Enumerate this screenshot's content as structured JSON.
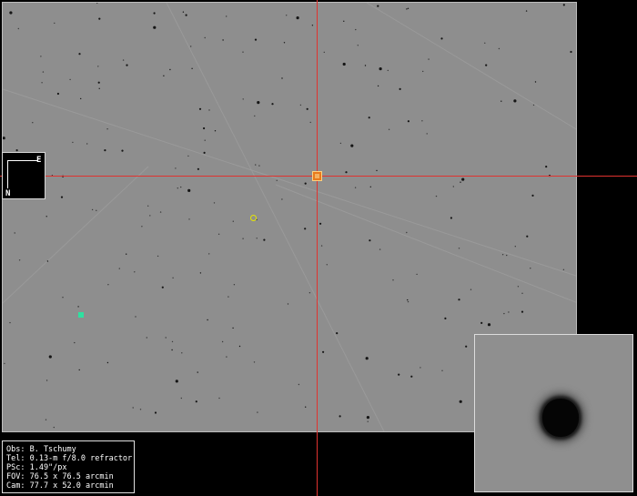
{
  "compass": {
    "east_label": "E",
    "north_label": "N"
  },
  "info": {
    "observer": "Obs: B. Tschumy",
    "telescope": "Tel: 0.13-m f/8.0 refractor",
    "pixel_scale": "PSc: 1.49\"/px",
    "fov": "FOV: 76.5 x 76.5 arcmin",
    "camera": "Cam: 77.7 x 52.0 arcmin"
  },
  "markers": {
    "target_color": "#e87a1c",
    "comparison_color": "#e6e600",
    "check_color": "#2fe0a0",
    "crosshair_color": "#e0332f"
  },
  "icons": [
    "compass-icon",
    "target-marker",
    "comparison-marker",
    "check-marker"
  ]
}
